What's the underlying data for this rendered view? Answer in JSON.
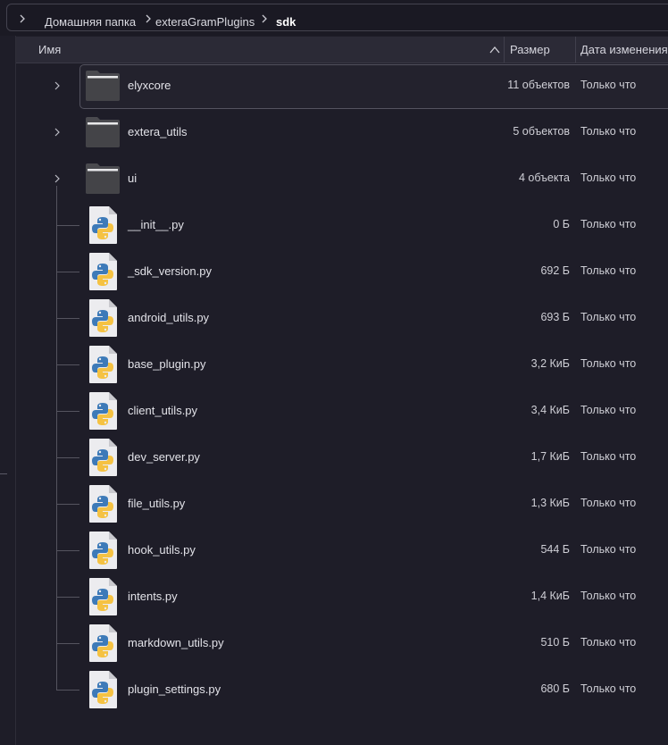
{
  "breadcrumb": {
    "items": [
      "Домашняя папка",
      "exteraGramPlugins",
      "sdk"
    ]
  },
  "columns": {
    "name": "Имя",
    "size": "Размер",
    "modified": "Дата изменения"
  },
  "files": [
    {
      "name": "elyxcore",
      "type": "folder",
      "size": "11 объектов",
      "modified": "Только что",
      "selected": true
    },
    {
      "name": "extera_utils",
      "type": "folder",
      "size": "5 объектов",
      "modified": "Только что"
    },
    {
      "name": "ui",
      "type": "folder",
      "size": "4 объекта",
      "modified": "Только что"
    },
    {
      "name": "__init__.py",
      "type": "python",
      "size": "0 Б",
      "modified": "Только что"
    },
    {
      "name": "_sdk_version.py",
      "type": "python",
      "size": "692 Б",
      "modified": "Только что"
    },
    {
      "name": "android_utils.py",
      "type": "python",
      "size": "693 Б",
      "modified": "Только что"
    },
    {
      "name": "base_plugin.py",
      "type": "python",
      "size": "3,2 КиБ",
      "modified": "Только что"
    },
    {
      "name": "client_utils.py",
      "type": "python",
      "size": "3,4 КиБ",
      "modified": "Только что"
    },
    {
      "name": "dev_server.py",
      "type": "python",
      "size": "1,7 КиБ",
      "modified": "Только что"
    },
    {
      "name": "file_utils.py",
      "type": "python",
      "size": "1,3 КиБ",
      "modified": "Только что"
    },
    {
      "name": "hook_utils.py",
      "type": "python",
      "size": "544 Б",
      "modified": "Только что"
    },
    {
      "name": "intents.py",
      "type": "python",
      "size": "1,4 КиБ",
      "modified": "Только что"
    },
    {
      "name": "markdown_utils.py",
      "type": "python",
      "size": "510 Б",
      "modified": "Только что"
    },
    {
      "name": "plugin_settings.py",
      "type": "python",
      "size": "680 Б",
      "modified": "Только что"
    }
  ],
  "icons": {
    "folder": "folder-icon",
    "python": "python-file-icon",
    "expander": "chevron-right-icon",
    "sort": "chevron-up-icon"
  },
  "colors": {
    "background": "#1e1d28",
    "header": "#2b2a36",
    "folder": "#4a4a4f",
    "python_blue": "#3d7ab8",
    "python_yellow": "#f5c242"
  }
}
